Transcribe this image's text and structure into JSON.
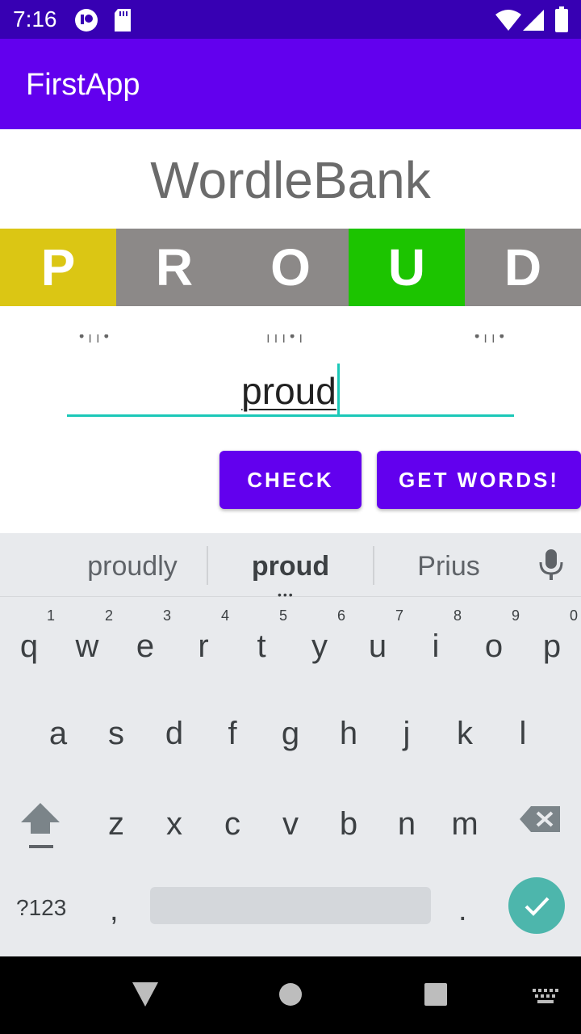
{
  "status_bar": {
    "time": "7:16"
  },
  "app_bar": {
    "title": "FirstApp"
  },
  "heading": "WordleBank",
  "tiles": [
    {
      "letter": "P",
      "color": "#dbc614"
    },
    {
      "letter": "R",
      "color": "#8c8988"
    },
    {
      "letter": "O",
      "color": "#8c8988"
    },
    {
      "letter": "U",
      "color": "#1cc400"
    },
    {
      "letter": "D",
      "color": "#8c8988"
    }
  ],
  "word_input": {
    "value": "proud"
  },
  "buttons": {
    "check": "CHECK",
    "get_words": "GET WORDS!"
  },
  "keyboard": {
    "suggestions": [
      "proudly",
      "proud",
      "Prius"
    ],
    "row1": [
      {
        "key": "q",
        "hint": "1"
      },
      {
        "key": "w",
        "hint": "2"
      },
      {
        "key": "e",
        "hint": "3"
      },
      {
        "key": "r",
        "hint": "4"
      },
      {
        "key": "t",
        "hint": "5"
      },
      {
        "key": "y",
        "hint": "6"
      },
      {
        "key": "u",
        "hint": "7"
      },
      {
        "key": "i",
        "hint": "8"
      },
      {
        "key": "o",
        "hint": "9"
      },
      {
        "key": "p",
        "hint": "0"
      }
    ],
    "row2": [
      "a",
      "s",
      "d",
      "f",
      "g",
      "h",
      "j",
      "k",
      "l"
    ],
    "row3": [
      "z",
      "x",
      "c",
      "v",
      "b",
      "n",
      "m"
    ],
    "symbols_key": "?123",
    "comma_key": ",",
    "period_key": "."
  },
  "colors": {
    "status_bar": "#3700b3",
    "app_bar": "#6200ee",
    "accent": "#1bc8b8",
    "enter_key": "#4db6ac"
  }
}
